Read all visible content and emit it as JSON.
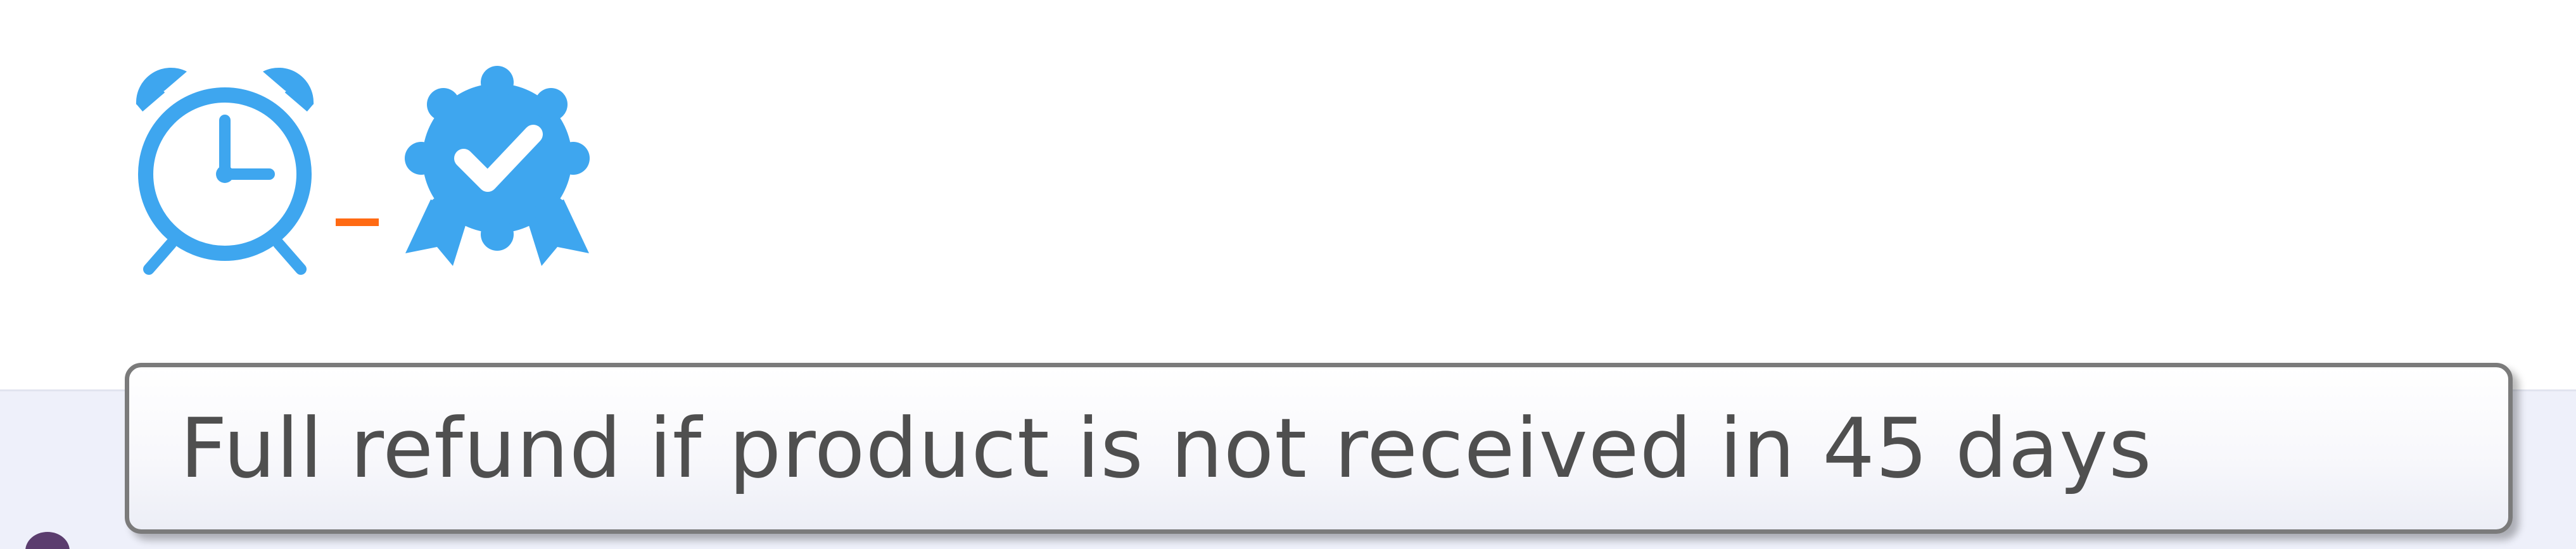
{
  "icons": {
    "clock": "alarm-clock-icon",
    "badge": "verified-badge-icon",
    "separator_color": "#ff6a13",
    "icon_color": "#3ea6ef"
  },
  "tooltip": {
    "text": "Full refund if product is not received in 45 days"
  }
}
